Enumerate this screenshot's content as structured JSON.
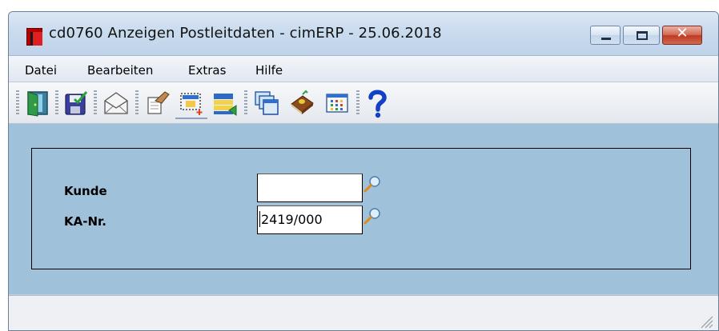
{
  "window": {
    "title": "cd0760 Anzeigen Postleitdaten - cimERP - 25.06.2018"
  },
  "caption_buttons": [
    "minimize",
    "maximize",
    "close"
  ],
  "close_glyph": "✕",
  "menu": [
    {
      "label": "Datei"
    },
    {
      "label": "Bearbeiten"
    },
    {
      "label": "Extras"
    },
    {
      "label": "Hilfe"
    }
  ],
  "toolbar": {
    "icons": [
      "exit-door-icon",
      "save-icon",
      "mail-icon",
      "edit-hand-icon",
      "new-record-icon",
      "transfer-list-icon",
      "windows-cascade-icon",
      "book-icon",
      "calculator-icon",
      "help-icon"
    ]
  },
  "form": {
    "kunde": {
      "label": "Kunde",
      "value": ""
    },
    "ka_nr": {
      "label": "KA-Nr.",
      "value": "2419/000"
    }
  },
  "colors": {
    "panel_bg": "#9fc1d9",
    "title_bg": "#c9dbee",
    "close_red": "#c4452c"
  }
}
